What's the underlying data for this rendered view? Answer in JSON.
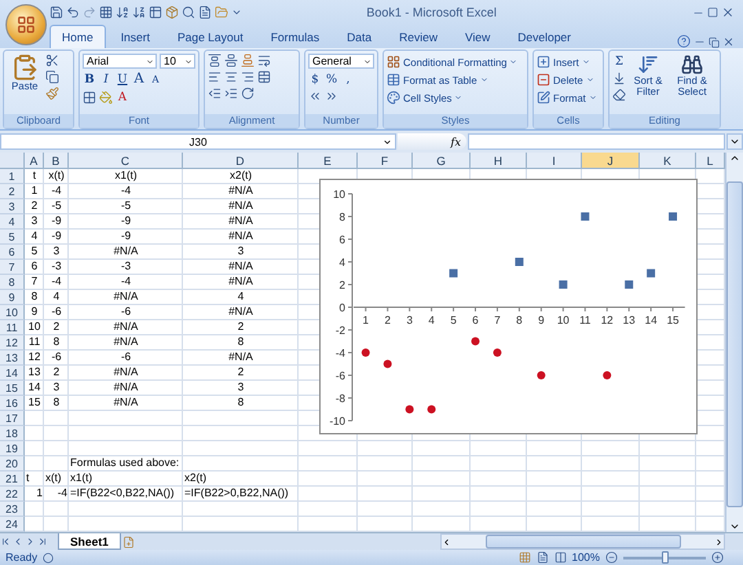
{
  "window": {
    "title": "Book1 - Microsoft Excel"
  },
  "ribbon_tabs": [
    {
      "label": "Home",
      "selected": true
    },
    {
      "label": "Insert",
      "selected": false
    },
    {
      "label": "Page Layout",
      "selected": false
    },
    {
      "label": "Formulas",
      "selected": false
    },
    {
      "label": "Data",
      "selected": false
    },
    {
      "label": "Review",
      "selected": false
    },
    {
      "label": "View",
      "selected": false
    },
    {
      "label": "Developer",
      "selected": false
    }
  ],
  "ribbon": {
    "clipboard": {
      "paste": "Paste",
      "label": "Clipboard"
    },
    "font": {
      "name": "Arial",
      "size": "10",
      "style_buttons": [
        "B",
        "I",
        "U"
      ],
      "grow": "A",
      "shrink": "A",
      "color_button": "A",
      "label": "Font"
    },
    "alignment": {
      "label": "Alignment"
    },
    "number": {
      "format": "General",
      "buttons": [
        "$",
        "%",
        ","
      ],
      "label": "Number"
    },
    "styles": {
      "items": [
        "Conditional Formatting",
        "Format as Table",
        "Cell Styles"
      ],
      "label": "Styles"
    },
    "cells": {
      "items": [
        "Insert",
        "Delete",
        "Format"
      ],
      "label": "Cells"
    },
    "editing": {
      "sum": "Σ",
      "sort": "Sort & Filter",
      "find": "Find & Select",
      "label": "Editing"
    }
  },
  "formula_bar": {
    "name_box": "J30",
    "function_button": "fx"
  },
  "columns": [
    {
      "label": "A",
      "selected": false
    },
    {
      "label": "B",
      "selected": false
    },
    {
      "label": "C",
      "selected": false
    },
    {
      "label": "D",
      "selected": false
    },
    {
      "label": "E",
      "selected": false
    },
    {
      "label": "F",
      "selected": false
    },
    {
      "label": "G",
      "selected": false
    },
    {
      "label": "H",
      "selected": false
    },
    {
      "label": "I",
      "selected": false
    },
    {
      "label": "J",
      "selected": true
    },
    {
      "label": "K",
      "selected": false
    },
    {
      "label": "L",
      "selected": false
    }
  ],
  "rows": [
    {
      "number": "1",
      "kind": "table",
      "cells": [
        "t",
        "x(t)",
        "x1(t)",
        "x2(t)"
      ]
    },
    {
      "number": "2",
      "kind": "table",
      "cells": [
        "1",
        "-4",
        "-4",
        "#N/A"
      ]
    },
    {
      "number": "3",
      "kind": "table",
      "cells": [
        "2",
        "-5",
        "-5",
        "#N/A"
      ]
    },
    {
      "number": "4",
      "kind": "table",
      "cells": [
        "3",
        "-9",
        "-9",
        "#N/A"
      ]
    },
    {
      "number": "5",
      "kind": "table",
      "cells": [
        "4",
        "-9",
        "-9",
        "#N/A"
      ]
    },
    {
      "number": "6",
      "kind": "table",
      "cells": [
        "5",
        "3",
        "#N/A",
        "3"
      ]
    },
    {
      "number": "7",
      "kind": "table",
      "cells": [
        "6",
        "-3",
        "-3",
        "#N/A"
      ]
    },
    {
      "number": "8",
      "kind": "table",
      "cells": [
        "7",
        "-4",
        "-4",
        "#N/A"
      ]
    },
    {
      "number": "9",
      "kind": "table",
      "cells": [
        "8",
        "4",
        "#N/A",
        "4"
      ]
    },
    {
      "number": "10",
      "kind": "table",
      "cells": [
        "9",
        "-6",
        "-6",
        "#N/A"
      ]
    },
    {
      "number": "11",
      "kind": "table",
      "cells": [
        "10",
        "2",
        "#N/A",
        "2"
      ]
    },
    {
      "number": "12",
      "kind": "table",
      "cells": [
        "11",
        "8",
        "#N/A",
        "8"
      ]
    },
    {
      "number": "13",
      "kind": "table",
      "cells": [
        "12",
        "-6",
        "-6",
        "#N/A"
      ]
    },
    {
      "number": "14",
      "kind": "table",
      "cells": [
        "13",
        "2",
        "#N/A",
        "2"
      ]
    },
    {
      "number": "15",
      "kind": "table",
      "cells": [
        "14",
        "3",
        "#N/A",
        "3"
      ]
    },
    {
      "number": "16",
      "kind": "table",
      "cells": [
        "15",
        "8",
        "#N/A",
        "8"
      ]
    },
    {
      "number": "17"
    },
    {
      "number": "18"
    },
    {
      "number": "19"
    },
    {
      "number": "20",
      "kind": "text",
      "cells": [
        null,
        null,
        "Formulas used above:"
      ]
    },
    {
      "number": "21",
      "kind": "text",
      "cells": [
        "t",
        "x(t)",
        "x1(t)",
        "x2(t)"
      ]
    },
    {
      "number": "22",
      "kind": "example",
      "cells": [
        "1",
        "-4",
        "=IF(B22<0,B22,NA())",
        "=IF(B22>0,B22,NA())"
      ]
    },
    {
      "number": "23"
    },
    {
      "number": "24"
    }
  ],
  "chart_data": {
    "type": "scatter",
    "x": [
      1,
      2,
      3,
      4,
      5,
      6,
      7,
      8,
      9,
      10,
      11,
      12,
      13,
      14,
      15
    ],
    "series": [
      {
        "color": "#cc1122",
        "values": [
          -4,
          -5,
          -9,
          -9,
          null,
          -3,
          -4,
          null,
          -6,
          null,
          null,
          -6,
          null,
          null,
          null
        ]
      },
      {
        "color": "#4a6fa5",
        "values": [
          null,
          null,
          null,
          null,
          3,
          null,
          null,
          4,
          null,
          2,
          8,
          null,
          2,
          3,
          8
        ]
      }
    ],
    "xlim": [
      0.45,
      15.55
    ],
    "ylim": [
      -10,
      10
    ],
    "xticks": [
      1,
      2,
      3,
      4,
      5,
      6,
      7,
      8,
      9,
      10,
      11,
      12,
      13,
      14,
      15
    ],
    "yticks": [
      -10,
      -8,
      -6,
      -4,
      -2,
      0,
      2,
      4,
      6,
      8,
      10
    ]
  },
  "sheet_tabs": [
    {
      "label": "Sheet1",
      "selected": true
    }
  ],
  "status_bar": {
    "text": "Ready",
    "zoom": "100%",
    "zoom_slider": {
      "level": 0.5
    }
  }
}
